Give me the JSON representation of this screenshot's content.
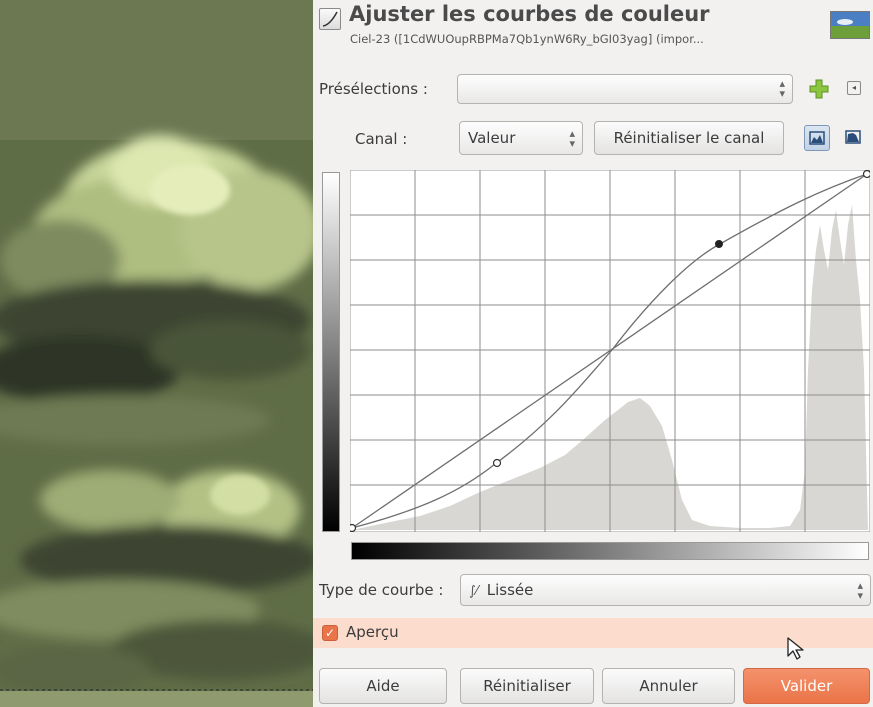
{
  "dialog": {
    "title": "Ajuster les courbes de couleur",
    "subtitle": "Ciel-23 ([1CdWUOupRBPMa7Qb1ynW6Ry_bGI03yag] (impor...",
    "presets_label": "Présélections :",
    "presets_value": "",
    "channel_label": "Canal :",
    "channel_value": "Valeur",
    "reset_channel_label": "Réinitialiser le canal",
    "curve_type_label": "Type de courbe :",
    "curve_type_value": "Lissée",
    "preview_label": "Aperçu",
    "preview_checked": true
  },
  "buttons": {
    "help": "Aide",
    "reset": "Réinitialiser",
    "cancel": "Annuler",
    "ok": "Valider"
  },
  "icons": {
    "header": "curves-tool-icon",
    "thumbnail": "image-thumbnail-icon",
    "add_preset": "add-preset-icon",
    "preset_menu": "preset-menu-icon",
    "linear_histogram": "linear-histogram-icon",
    "log_histogram": "logarithmic-histogram-icon",
    "curve_type": "smooth-curve-icon",
    "cursor": "mouse-pointer-icon"
  },
  "colors": {
    "accent": "#ea7448",
    "preview_row": "#fbdccd",
    "canvas_tint": "#5f6d47"
  }
}
